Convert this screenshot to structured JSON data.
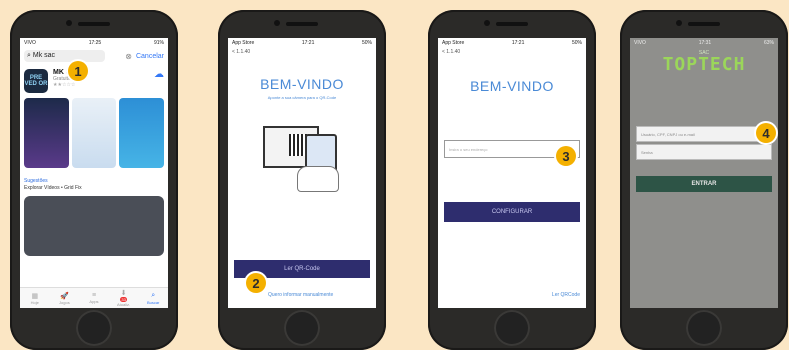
{
  "phone1": {
    "status_time": "17:25",
    "status_left": "VIVO",
    "status_right": "91%",
    "search_text": "Mk sac",
    "cancel_label": "Cancelar",
    "app_name": "MK SAC",
    "app_icon_text": "PRE VED OR",
    "app_dev": "Gratuito",
    "app_stars": "★★☆☆☆",
    "section_title": "Sugestões",
    "section_sub": "Explorar Vídeos • Grid Fix",
    "tabs": [
      {
        "label": "Hoje",
        "icon": "▦"
      },
      {
        "label": "Jogos",
        "icon": "🚀"
      },
      {
        "label": "Apps",
        "icon": "≡"
      },
      {
        "label": "Atualiz.",
        "icon": "⬇",
        "count": "33"
      },
      {
        "label": "Buscar",
        "icon": "⌕"
      }
    ],
    "badge": "1"
  },
  "phone2": {
    "status_left": "App Store",
    "status_time": "17:21",
    "status_right": "50%",
    "sub": "< 1.1.40",
    "welcome": "BEM-VINDO",
    "welcome_sub": "Aponte a sua câmera para o QR-Code",
    "qr_button": "Ler QR-Code",
    "manual_link": "Quero informar manualmente",
    "badge": "2"
  },
  "phone3": {
    "status_left": "App Store",
    "status_time": "17:21",
    "status_right": "50%",
    "sub": "< 1.1.40",
    "welcome": "BEM-VINDO",
    "input_placeholder": "Insira o seu endereço",
    "configure_button": "CONFIGURAR",
    "qr_link": "Ler QRCode",
    "badge": "3"
  },
  "phone4": {
    "status_left": "VIVO",
    "status_time": "17:31",
    "status_right": "63%",
    "sac": "SAC",
    "logo": "TOPTECH",
    "user_placeholder": "Usuário, CPF, CNPJ ou e-mail",
    "password_placeholder": "Senha",
    "login_button": "ENTRAR",
    "badge": "4"
  }
}
